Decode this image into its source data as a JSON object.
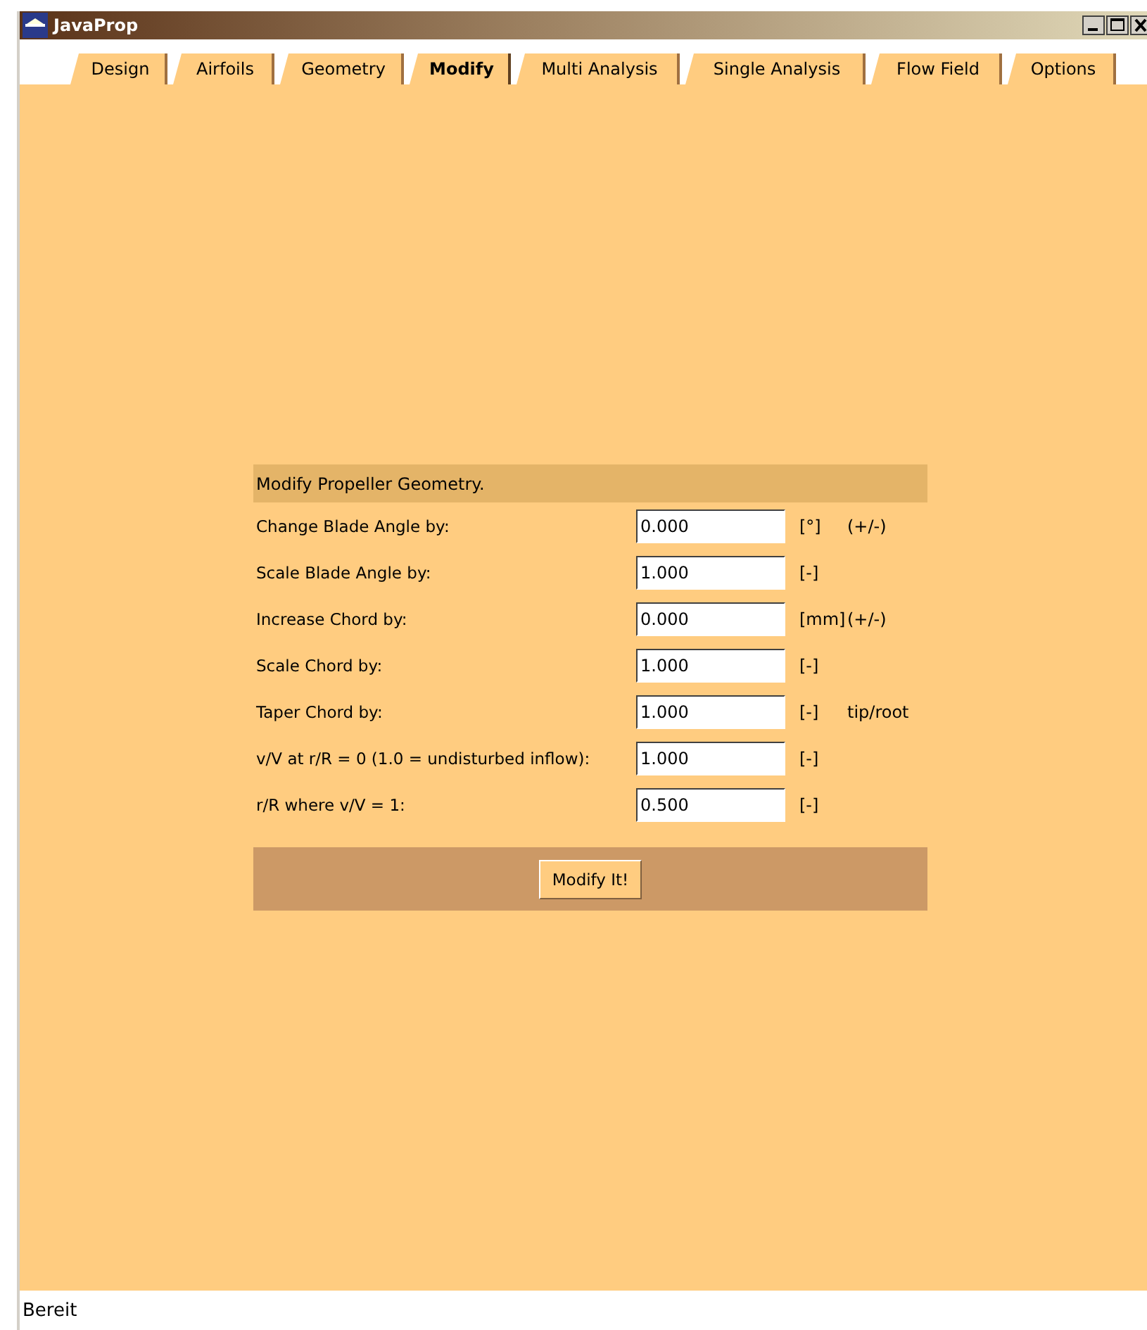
{
  "window": {
    "title": "JavaProp"
  },
  "tabs": [
    {
      "label": "Design",
      "selected": false
    },
    {
      "label": "Airfoils",
      "selected": false
    },
    {
      "label": "Geometry",
      "selected": false
    },
    {
      "label": "Modify",
      "selected": true
    },
    {
      "label": "Multi Analysis",
      "selected": false
    },
    {
      "label": "Single Analysis",
      "selected": false
    },
    {
      "label": "Flow Field",
      "selected": false
    },
    {
      "label": "Options",
      "selected": false
    }
  ],
  "form": {
    "header": "Modify Propeller Geometry.",
    "rows": [
      {
        "label": "Change Blade Angle by:",
        "value": "0.000",
        "unit": "[°]",
        "note": "(+/-)"
      },
      {
        "label": "Scale Blade Angle by:",
        "value": "1.000",
        "unit": "[-]"
      },
      {
        "label": "Increase Chord by:",
        "value": "0.000",
        "unit": "[mm]",
        "note": "(+/-)"
      },
      {
        "label": "Scale Chord by:",
        "value": "1.000",
        "unit": "[-]"
      },
      {
        "label": "Taper Chord by:",
        "value": "1.000",
        "unit": "[-]",
        "note": "tip/root"
      },
      {
        "label": "v/V at r/R = 0 (1.0 = undisturbed inflow):",
        "value": "1.000",
        "unit": "[-]"
      },
      {
        "label": "r/R where v/V = 1:",
        "value": "0.500",
        "unit": "[-]"
      }
    ],
    "button": "Modify It!"
  },
  "status_bar": "Bereit"
}
